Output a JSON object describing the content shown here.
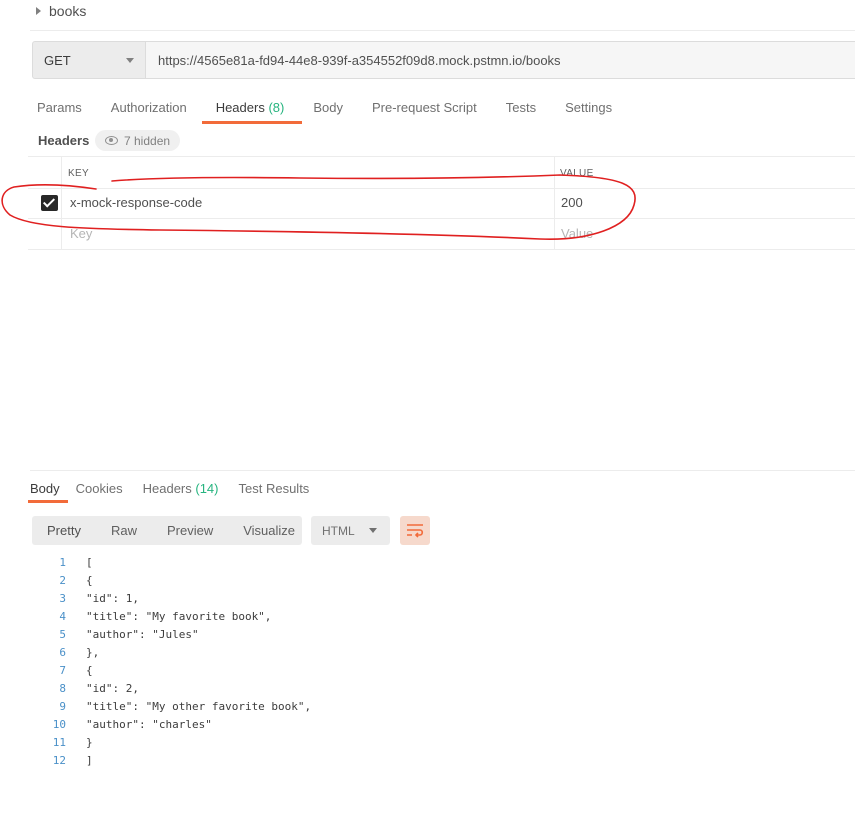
{
  "collection": {
    "name": "books"
  },
  "request": {
    "method": "GET",
    "url": "https://4565e81a-fd94-44e8-939f-a354552f09d8.mock.pstmn.io/books"
  },
  "request_tabs": [
    {
      "label": "Params"
    },
    {
      "label": "Authorization"
    },
    {
      "label": "Headers",
      "count": "(8)"
    },
    {
      "label": "Body"
    },
    {
      "label": "Pre-request Script"
    },
    {
      "label": "Tests"
    },
    {
      "label": "Settings"
    }
  ],
  "headers_section": {
    "title": "Headers",
    "hidden_label": "7 hidden",
    "col_key": "KEY",
    "col_value": "VALUE",
    "rows": [
      {
        "key": "x-mock-response-code",
        "value": "200",
        "checked": true
      }
    ],
    "key_placeholder": "Key",
    "value_placeholder": "Value"
  },
  "response_tabs": [
    {
      "label": "Body"
    },
    {
      "label": "Cookies"
    },
    {
      "label": "Headers",
      "count": "(14)"
    },
    {
      "label": "Test Results"
    }
  ],
  "format_options": [
    {
      "label": "Pretty"
    },
    {
      "label": "Raw"
    },
    {
      "label": "Preview"
    },
    {
      "label": "Visualize"
    }
  ],
  "language": "HTML",
  "code_lines": [
    {
      "n": "1",
      "text": "["
    },
    {
      "n": "2",
      "text": "{"
    },
    {
      "n": "3",
      "text": "\"id\": 1,"
    },
    {
      "n": "4",
      "text": "\"title\": \"My favorite book\","
    },
    {
      "n": "5",
      "text": "\"author\": \"Jules\""
    },
    {
      "n": "6",
      "text": "},"
    },
    {
      "n": "7",
      "text": "{"
    },
    {
      "n": "8",
      "text": "\"id\": 2,"
    },
    {
      "n": "9",
      "text": "\"title\": \"My other favorite book\","
    },
    {
      "n": "10",
      "text": "\"author\": \"charles\""
    },
    {
      "n": "11",
      "text": "}"
    },
    {
      "n": "12",
      "text": "]"
    }
  ],
  "colors": {
    "accent": "#f26b3a",
    "count": "#26b47f",
    "annotation": "#e02020"
  }
}
